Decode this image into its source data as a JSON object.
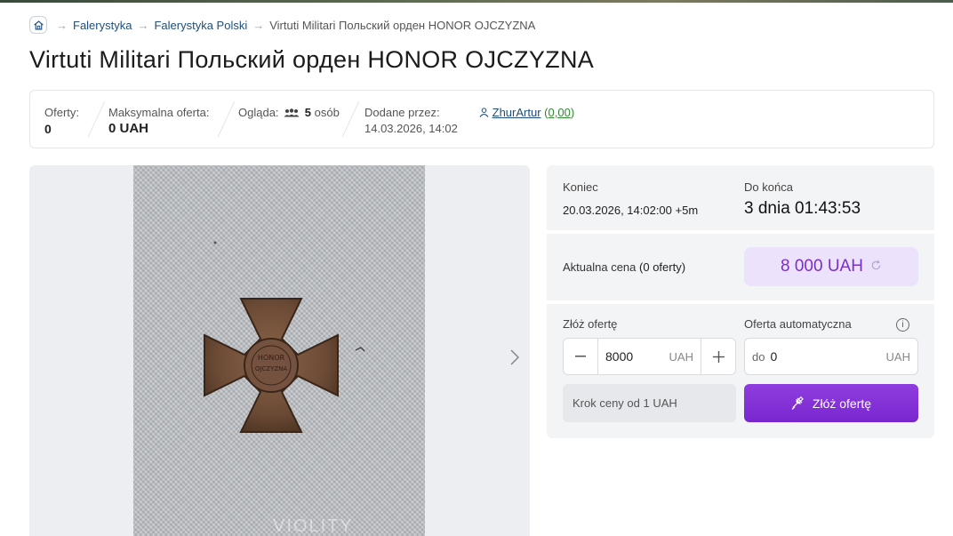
{
  "breadcrumb": {
    "items": [
      "Falerystyka",
      "Falerystyka Polski"
    ],
    "current": "Virtuti Militari Польский орден HONOR OJCZYZNA",
    "arrow": "→"
  },
  "title": "Virtuti Militari Польский орден HONOR OJCZYZNA",
  "info": {
    "offers_label": "Oferty:",
    "offers_value": "0",
    "max_offer_label": "Maksymalna oferta:",
    "max_offer_value": "0 UAH",
    "watching_label": "Ogląda:",
    "watching_value": "5",
    "watching_unit": "osób",
    "added_label": "Dodane przez:",
    "added_date": "14.03.2026, 14:02",
    "seller": "ZhurArtur",
    "seller_rating": "0,00"
  },
  "gallery": {
    "watermark": "VIOLITY",
    "medal_text_top": "HONOR",
    "medal_text_bottom": "OJCZYZNA"
  },
  "auction": {
    "end_label": "Koniec",
    "end_value": "20.03.2026, 14:02:00 +5m",
    "remaining_label": "Do końca",
    "remaining_value": "3 dnia 01:43:53",
    "price_label": "Aktualna cena",
    "price_offers": "(0 oferty)",
    "price_value": "8 000 UAH",
    "bid_label": "Złóż ofertę",
    "bid_value": "8000",
    "currency": "UAH",
    "auto_label": "Oferta automatyczna",
    "auto_prefix": "do",
    "auto_value": "0",
    "step_note": "Krok ceny od 1 UAH",
    "bid_button": "Złóż ofertę"
  },
  "colors": {
    "accent": "#7a26cf",
    "price_bg": "#ece2fb",
    "link": "#1f4e79"
  }
}
